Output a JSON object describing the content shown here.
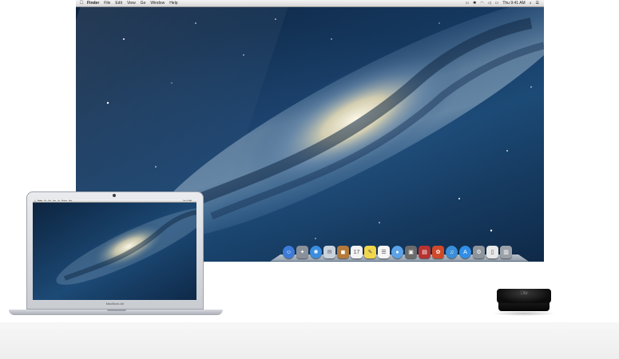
{
  "desktop": {
    "apple_menu_icon": "apple-logo-icon",
    "app_name": "Finder",
    "menus": [
      "File",
      "Edit",
      "View",
      "Go",
      "Window",
      "Help"
    ],
    "status_icons": [
      "airplay-icon",
      "bluetooth-icon",
      "wifi-icon",
      "volume-icon",
      "battery-icon"
    ],
    "clock": "Thu 9:41 AM",
    "spotlight_icon": "spotlight-search-icon",
    "notification_icon": "notification-center-icon",
    "wallpaper": "Mountain Lion galaxy"
  },
  "dock": {
    "items": [
      {
        "name": "finder-icon",
        "glyph": "☺",
        "color": "#3d7bd9"
      },
      {
        "name": "launchpad-icon",
        "glyph": "✦",
        "color": "#8a9099"
      },
      {
        "name": "safari-icon",
        "glyph": "✺",
        "color": "#3a8ee0"
      },
      {
        "name": "mail-icon",
        "glyph": "✉",
        "color": "#c9d3de"
      },
      {
        "name": "contacts-icon",
        "glyph": "◼",
        "color": "#b57a3a"
      },
      {
        "name": "calendar-icon",
        "glyph": "17",
        "color": "#f3f3f3"
      },
      {
        "name": "notes-icon",
        "glyph": "✎",
        "color": "#f2d64b"
      },
      {
        "name": "reminders-icon",
        "glyph": "☰",
        "color": "#f5f5f5"
      },
      {
        "name": "messages-icon",
        "glyph": "●",
        "color": "#5aa3e8"
      },
      {
        "name": "facetime-icon",
        "glyph": "▣",
        "color": "#6b6b6b"
      },
      {
        "name": "photo-booth-icon",
        "glyph": "▤",
        "color": "#b8322f"
      },
      {
        "name": "iphoto-icon",
        "glyph": "✿",
        "color": "#d04a2a"
      },
      {
        "name": "itunes-icon",
        "glyph": "♫",
        "color": "#3b8ed8"
      },
      {
        "name": "app-store-icon",
        "glyph": "A",
        "color": "#2f8fe6"
      },
      {
        "name": "system-preferences-icon",
        "glyph": "⚙",
        "color": "#8e949b"
      },
      {
        "name": "documents-stack-icon",
        "glyph": "▯",
        "color": "#e8e8e8"
      },
      {
        "name": "trash-icon",
        "glyph": "▥",
        "color": "#9aa1a8"
      }
    ]
  },
  "laptop": {
    "label": "MacBook Air"
  },
  "appletv": {
    "logo": "tv"
  },
  "colors": {
    "space_dark": "#0d2440",
    "space_mid": "#1c4a76",
    "galaxy_core": "#f1ecd8",
    "menubar": "#e6e6e6"
  }
}
